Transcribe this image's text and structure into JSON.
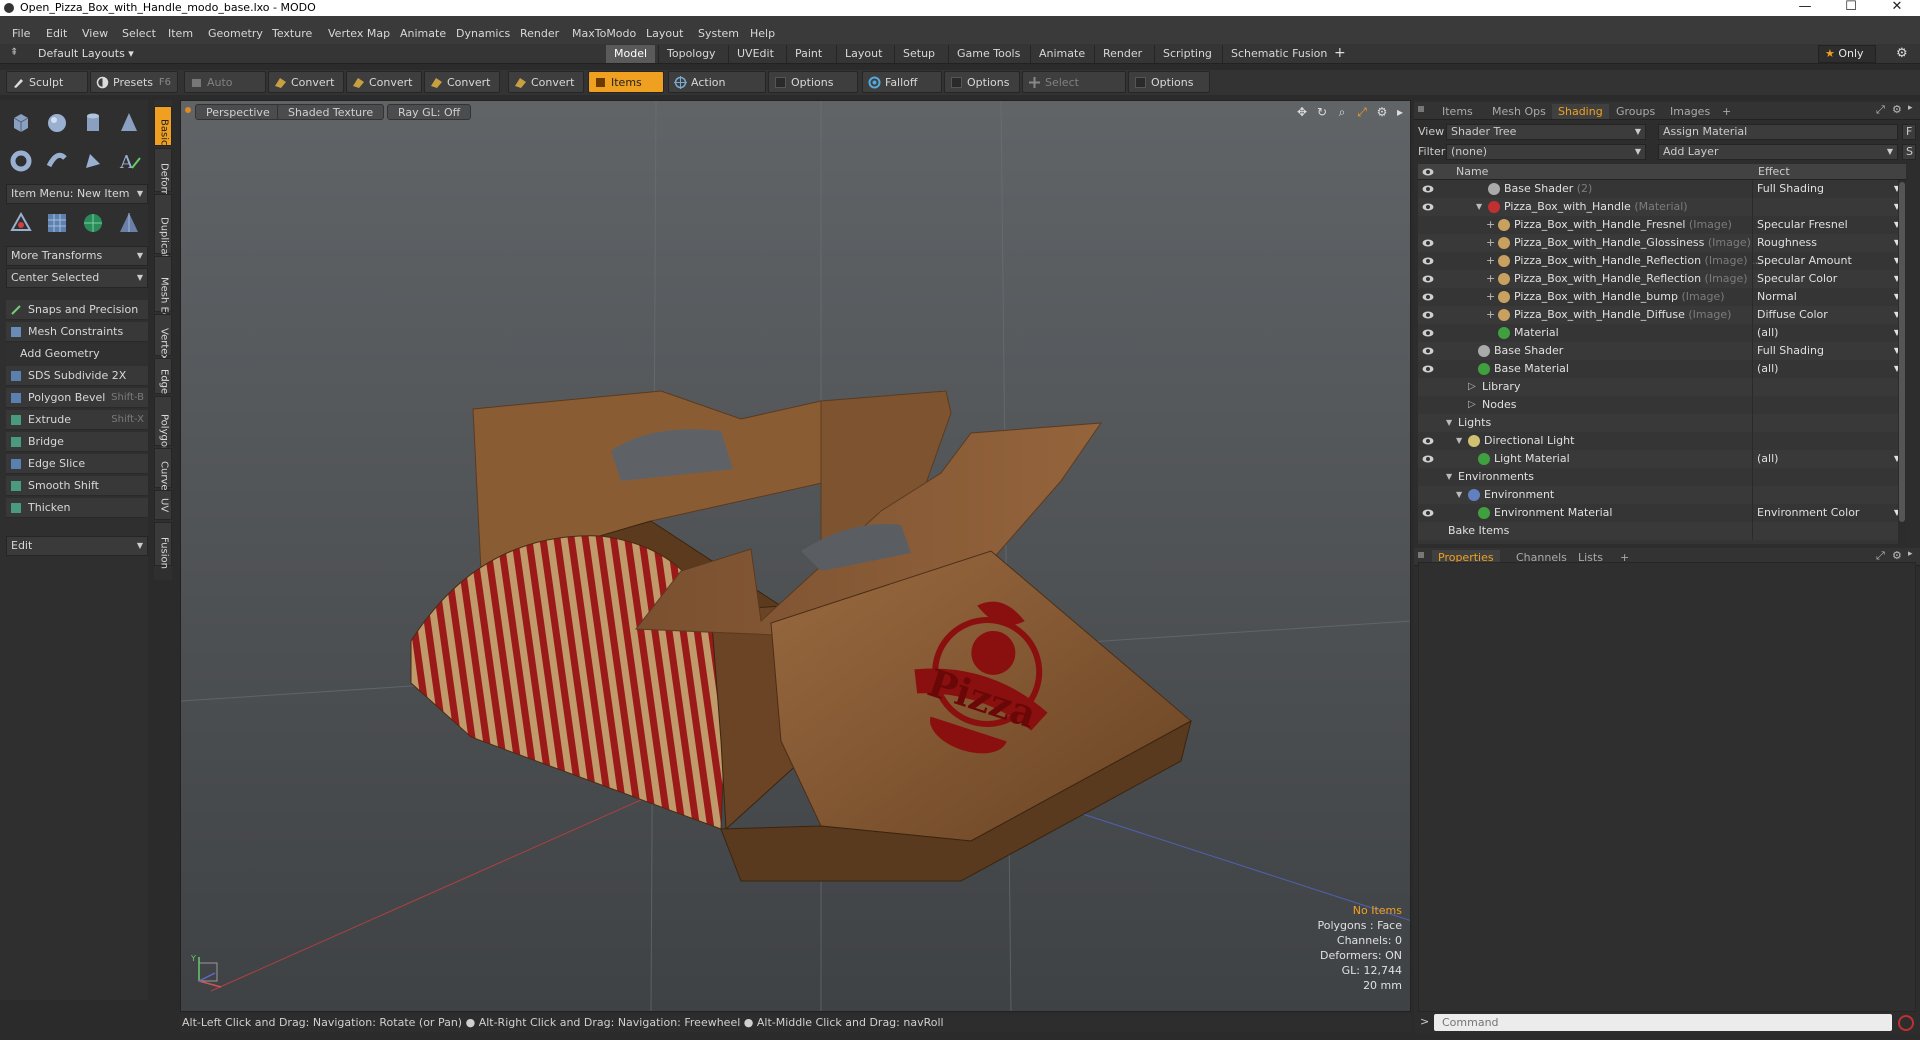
{
  "window": {
    "title": "Open_Pizza_Box_with_Handle_modo_base.lxo - MODO",
    "minimize": "—",
    "maximize": "☐",
    "close": "✕"
  },
  "menu": [
    "File",
    "Edit",
    "View",
    "Select",
    "Item",
    "Geometry",
    "Texture",
    "Vertex Map",
    "Animate",
    "Dynamics",
    "Render",
    "MaxToModo",
    "Layout",
    "System",
    "Help"
  ],
  "layout_bar": {
    "layouts_label": "Default Layouts ▾",
    "tabs": [
      "Model",
      "Topology",
      "UVEdit",
      "Paint",
      "Layout",
      "Setup",
      "Game Tools",
      "Animate",
      "Render",
      "Scripting",
      "Schematic Fusion"
    ],
    "active_tab": "Model",
    "add": "+",
    "only_label": "Only",
    "star": "★",
    "gear": "⚙"
  },
  "toolbar": {
    "sculpt": "Sculpt",
    "presets": "Presets",
    "presets_hint": "F6",
    "auto_select": "Auto Select",
    "convert1": "Convert",
    "convert2": "Convert",
    "convert3": "Convert",
    "convert4": "Convert",
    "items": "Items",
    "action_center": "Action Center",
    "options1": "Options",
    "falloff": "Falloff",
    "options2": "Options",
    "select_through": "Select Through",
    "options3": "Options"
  },
  "left_panel": {
    "item_menu": "Item Menu: New Item",
    "more_transforms": "More Transforms",
    "center_selected": "Center Selected",
    "snaps": "Snaps and Precision",
    "mesh_constraints": "Mesh Constraints",
    "add_geometry": "Add Geometry",
    "tools": [
      {
        "label": "SDS Subdivide 2X",
        "shortcut": ""
      },
      {
        "label": "Polygon Bevel",
        "shortcut": "Shift-B"
      },
      {
        "label": "Extrude",
        "shortcut": "Shift-X"
      },
      {
        "label": "Bridge",
        "shortcut": ""
      },
      {
        "label": "Edge Slice",
        "shortcut": ""
      },
      {
        "label": "Smooth Shift",
        "shortcut": ""
      },
      {
        "label": "Thicken",
        "shortcut": ""
      }
    ],
    "edit": "Edit"
  },
  "vertical_tabs": [
    "Basic",
    "Deform",
    "Duplicate",
    "Mesh Edit",
    "Vertex",
    "Edge",
    "Polygon",
    "Curve",
    "UV",
    "Fusion"
  ],
  "viewport": {
    "tabs": [
      "Perspective",
      "Shaded Texture",
      "Ray GL: Off"
    ],
    "pizza_text": "Pizza",
    "info": {
      "no_items": "No Items",
      "polygons": "Polygons : Face",
      "channels": "Channels: 0",
      "deformers": "Deformers: ON",
      "gl": "GL: 12,744",
      "scale": "20 mm"
    },
    "axis_y": "Y"
  },
  "status": "Alt-Left Click and Drag: Navigation: Rotate (or Pan) ● Alt-Right Click and Drag: Navigation: Freewheel ● Alt-Middle Click and Drag: navRoll",
  "right_panel": {
    "tabs": [
      "Items",
      "Mesh Ops",
      "Shading",
      "Groups",
      "Images"
    ],
    "active_tab": "Shading",
    "add": "+",
    "view_label": "View",
    "view_value": "Shader Tree",
    "assign_material": "Assign Material",
    "f_button": "F",
    "filter_label": "Filter",
    "filter_value": "(none)",
    "add_layer": "Add Layer",
    "s_button": "S",
    "tree_header": {
      "name": "Name",
      "effect": "Effect"
    },
    "tree": [
      {
        "name": "Base Shader",
        "sub": "(2)",
        "effect": "Full Shading",
        "indent": 4,
        "icon": "#aaaaaa",
        "eye": true,
        "dd": true
      },
      {
        "name": "Pizza_Box_with_Handle",
        "sub": "(Material)",
        "effect": "",
        "indent": 4,
        "icon": "#c03030",
        "eye": true,
        "dd": true,
        "open": true
      },
      {
        "name": "Pizza_Box_with_Handle_Fresnel",
        "sub": "(Image)",
        "effect": "Specular Fresnel",
        "indent": 5,
        "icon": "#c8a060",
        "eye": false,
        "dd": true,
        "plus": true
      },
      {
        "name": "Pizza_Box_with_Handle_Glossiness",
        "sub": "(Image)",
        "effect": "Roughness",
        "indent": 5,
        "icon": "#c8a060",
        "eye": true,
        "dd": true,
        "plus": true
      },
      {
        "name": "Pizza_Box_with_Handle_Reflection",
        "sub": "(Image) ...",
        "effect": "Specular Amount",
        "indent": 5,
        "icon": "#c8a060",
        "eye": true,
        "dd": true,
        "plus": true
      },
      {
        "name": "Pizza_Box_with_Handle_Reflection",
        "sub": "(Image)",
        "effect": "Specular Color",
        "indent": 5,
        "icon": "#c8a060",
        "eye": true,
        "dd": true,
        "plus": true
      },
      {
        "name": "Pizza_Box_with_Handle_bump",
        "sub": "(Image)",
        "effect": "Normal",
        "indent": 5,
        "icon": "#c8a060",
        "eye": true,
        "dd": true,
        "plus": true
      },
      {
        "name": "Pizza_Box_with_Handle_Diffuse",
        "sub": "(Image)",
        "effect": "Diffuse Color",
        "indent": 5,
        "icon": "#c8a060",
        "eye": true,
        "dd": true,
        "plus": true
      },
      {
        "name": "Material",
        "sub": "",
        "effect": "(all)",
        "indent": 5,
        "icon": "#40a040",
        "eye": true,
        "dd": true
      },
      {
        "name": "Base Shader",
        "sub": "",
        "effect": "Full Shading",
        "indent": 3,
        "icon": "#aaaaaa",
        "eye": true,
        "dd": true
      },
      {
        "name": "Base Material",
        "sub": "",
        "effect": "(all)",
        "indent": 3,
        "icon": "#40a040",
        "eye": true,
        "dd": true
      },
      {
        "name": "Library",
        "sub": "",
        "effect": "",
        "indent": 2,
        "icon": "",
        "eye": false,
        "dd": false,
        "folder": true
      },
      {
        "name": "Nodes",
        "sub": "",
        "effect": "",
        "indent": 2,
        "icon": "",
        "eye": false,
        "dd": false,
        "folder": true
      },
      {
        "name": "Lights",
        "sub": "",
        "effect": "",
        "indent": 1,
        "icon": "",
        "eye": false,
        "dd": false,
        "open": true
      },
      {
        "name": "Directional Light",
        "sub": "",
        "effect": "",
        "indent": 2,
        "icon": "#d0c070",
        "eye": true,
        "dd": false,
        "open": true
      },
      {
        "name": "Light Material",
        "sub": "",
        "effect": "(all)",
        "indent": 3,
        "icon": "#40a040",
        "eye": true,
        "dd": true
      },
      {
        "name": "Environments",
        "sub": "",
        "effect": "",
        "indent": 1,
        "icon": "",
        "eye": false,
        "dd": false,
        "open": true
      },
      {
        "name": "Environment",
        "sub": "",
        "effect": "",
        "indent": 2,
        "icon": "#6080c0",
        "eye": false,
        "dd": false,
        "open": true
      },
      {
        "name": "Environment Material",
        "sub": "",
        "effect": "Environment Color",
        "indent": 3,
        "icon": "#40a040",
        "eye": true,
        "dd": true
      },
      {
        "name": "Bake Items",
        "sub": "",
        "effect": "",
        "indent": 0,
        "icon": "",
        "eye": false,
        "dd": false
      }
    ],
    "props_tabs": [
      "Properties",
      "Channels",
      "Lists"
    ],
    "props_active": "Properties",
    "command_placeholder": "Command"
  },
  "colors": {
    "accent": "#f0a020",
    "box_brown": "#8a5a34",
    "stripe_red": "#9a1a1a",
    "logo_red": "#8a1010"
  }
}
